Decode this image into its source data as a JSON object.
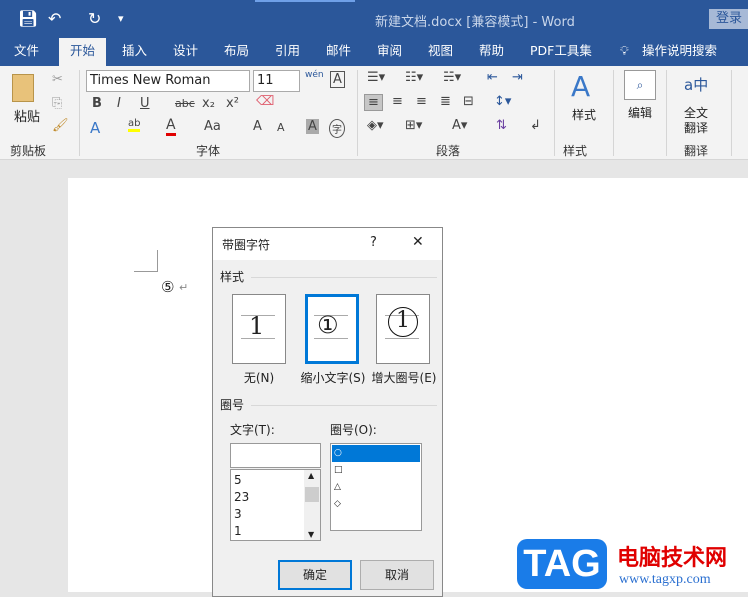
{
  "titlebar": {
    "title": "新建文档.docx [兼容模式]  -  Word",
    "login": "登录",
    "save_icon": "save-icon",
    "undo_icon": "undo-icon",
    "redo_icon": "redo-icon"
  },
  "tabs": [
    "文件",
    "开始",
    "插入",
    "设计",
    "布局",
    "引用",
    "邮件",
    "审阅",
    "视图",
    "帮助",
    "PDF工具集",
    "操作说明搜索"
  ],
  "active_tab": "开始",
  "ribbon": {
    "paste": "粘贴",
    "clipboard_group": "剪贴板",
    "font_name": "Times New Roman",
    "font_size": "11",
    "font_group": "字体",
    "bold": "B",
    "italic": "I",
    "underline": "U",
    "strike": "abc",
    "sub": "x₂",
    "sup": "x²",
    "para_group": "段落",
    "styles": "样式",
    "styles_group": "样式",
    "edit": "编辑",
    "translate": "全文翻译",
    "translate_group": "翻译",
    "phonetic": "wén",
    "char_border": "A",
    "grow": "A",
    "shrink": "A",
    "case": "Aa",
    "shade": "A",
    "enclose": "字",
    "highlight_color": "#ffff00",
    "font_color": "#e00000"
  },
  "document": {
    "enclosed_char": "⑤",
    "para_mark": "↵"
  },
  "dialog": {
    "title": "带圈字符",
    "help": "?",
    "close": "✕",
    "style_section": "样式",
    "options": [
      {
        "label": "无(N)",
        "sample": "1"
      },
      {
        "label": "缩小文字(S)",
        "sample": "①"
      },
      {
        "label": "增大圈号(E)",
        "sample": "1"
      }
    ],
    "selected_option": 1,
    "enclose_section": "圈号",
    "text_label": "文字(T):",
    "text_value": "",
    "text_list": [
      "5",
      "23",
      "3",
      "1"
    ],
    "enclosure_label": "圈号(O):",
    "enclosures": [
      "○",
      "□",
      "△",
      "◇"
    ],
    "selected_enclosure": 0,
    "ok": "确定",
    "cancel": "取消"
  },
  "watermark": {
    "logo": "TAG",
    "site": "电脑技术网",
    "url": "www.tagxp.com"
  }
}
